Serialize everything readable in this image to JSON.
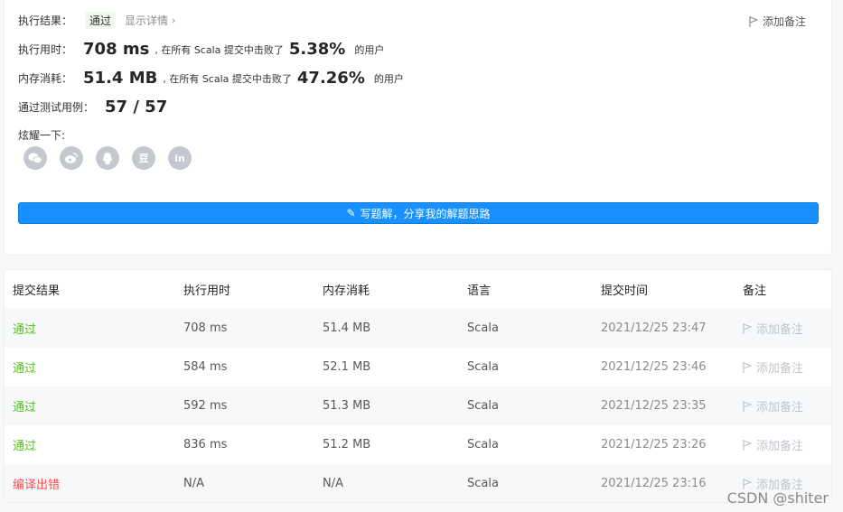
{
  "result": {
    "label": "执行结果：",
    "status": "通过",
    "detail_link": "显示详情",
    "chevron": "›",
    "add_note": "添加备注"
  },
  "runtime": {
    "label": "执行用时：",
    "value": "708 ms",
    "text_before": ", 在所有 Scala 提交中击败了",
    "percent": "5.38%",
    "text_after": "的用户"
  },
  "memory": {
    "label": "内存消耗：",
    "value": "51.4 MB",
    "text_before": ", 在所有 Scala 提交中击败了",
    "percent": "47.26%",
    "text_after": "的用户"
  },
  "tests": {
    "label": "通过测试用例：",
    "value": "57 / 57"
  },
  "share": {
    "label": "炫耀一下:",
    "icons": [
      "wechat-icon",
      "weibo-icon",
      "qq-icon",
      "douban-icon",
      "linkedin-icon"
    ],
    "douban_glyph": "豆",
    "linkedin_glyph": "in"
  },
  "write_solution": {
    "label": "写题解，分享我的解题思路"
  },
  "table": {
    "headers": [
      "提交结果",
      "执行用时",
      "内存消耗",
      "语言",
      "提交时间",
      "备注"
    ],
    "rows": [
      {
        "result": "通过",
        "status": "ok",
        "runtime": "708 ms",
        "memory": "51.4 MB",
        "language": "Scala",
        "time": "2021/12/25 23:47",
        "note": "添加备注"
      },
      {
        "result": "通过",
        "status": "ok",
        "runtime": "584 ms",
        "memory": "52.1 MB",
        "language": "Scala",
        "time": "2021/12/25 23:46",
        "note": "添加备注"
      },
      {
        "result": "通过",
        "status": "ok",
        "runtime": "592 ms",
        "memory": "51.3 MB",
        "language": "Scala",
        "time": "2021/12/25 23:35",
        "note": "添加备注"
      },
      {
        "result": "通过",
        "status": "ok",
        "runtime": "836 ms",
        "memory": "51.2 MB",
        "language": "Scala",
        "time": "2021/12/25 23:26",
        "note": "添加备注"
      },
      {
        "result": "编译出错",
        "status": "error",
        "runtime": "N/A",
        "memory": "N/A",
        "language": "Scala",
        "time": "2021/12/25 23:16",
        "note": "添加备注"
      }
    ]
  },
  "colors": {
    "accent": "#1890ff",
    "success": "#52c41a",
    "error": "#ff4d4f"
  },
  "watermark": "CSDN @shiter"
}
